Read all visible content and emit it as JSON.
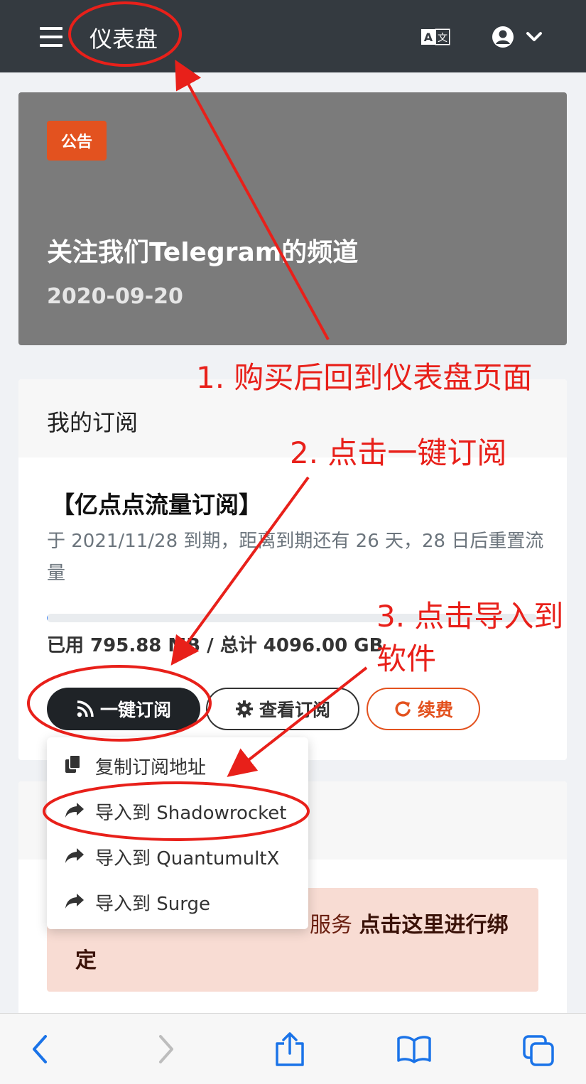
{
  "header": {
    "title": "仪表盘"
  },
  "notice": {
    "badge": "公告",
    "title": "关注我们Telegram的频道",
    "date": "2020-09-20"
  },
  "subscription": {
    "card_title": "我的订阅",
    "plan_name": "【亿点点流量订阅】",
    "expiry_text": "于 2021/11/28 到期，距离到期还有 26 天，28 日后重置流量",
    "usage_fraction": 0.0002,
    "usage_text": "已用 795.88 MB / 总计 4096.00 GB",
    "buttons": {
      "one_click": "一键订阅",
      "view": "查看订阅",
      "renew": "续费"
    }
  },
  "dropdown": {
    "items": [
      {
        "label": "复制订阅地址",
        "icon": "copy-icon"
      },
      {
        "label": "导入到 Shadowrocket",
        "icon": "share-icon"
      },
      {
        "label": "导入到 QuantumultX",
        "icon": "share-icon"
      },
      {
        "label": "导入到 Surge",
        "icon": "share-icon"
      }
    ]
  },
  "alert": {
    "text_partial": "服务",
    "text_bold": "点击这里进行绑定"
  },
  "annotations": {
    "step1": "1. 购买后回到仪表盘页面",
    "step2": "2. 点击一键订阅",
    "step3_line1": "3. 点击导入到",
    "step3_line2": "软件"
  },
  "colors": {
    "header_bg": "#343a40",
    "accent": "#e3521f",
    "annotation": "#e8201a"
  }
}
